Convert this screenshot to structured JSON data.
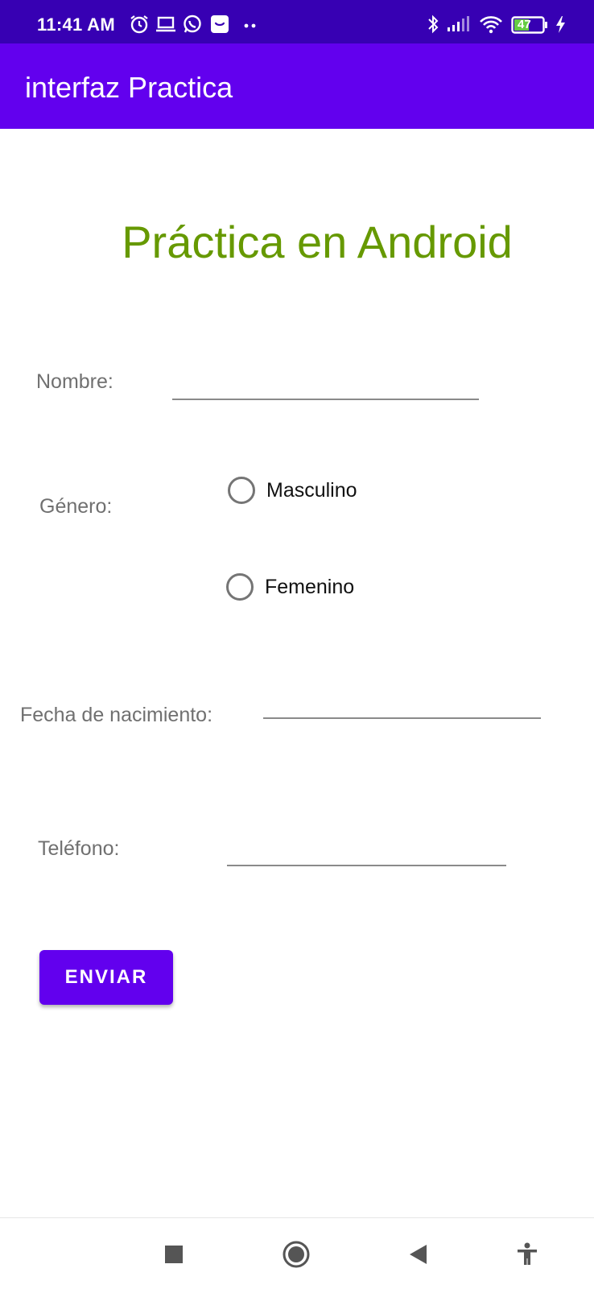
{
  "status_bar": {
    "time": "11:41 AM",
    "battery_level": "47",
    "icons": [
      "alarm-icon",
      "laptop-icon",
      "whatsapp-icon",
      "shop-icon",
      "more-dots-icon",
      "bluetooth-icon",
      "signal-icon",
      "wifi-icon",
      "battery-icon",
      "charging-icon"
    ]
  },
  "app_bar": {
    "title": "interfaz Practica"
  },
  "content": {
    "heading": "Práctica en Android",
    "name_label": "Nombre:",
    "gender_label": "Género:",
    "gender_options": [
      {
        "label": "Masculino",
        "selected": false
      },
      {
        "label": "Femenino",
        "selected": false
      }
    ],
    "birthdate_label": "Fecha de nacimiento:",
    "phone_label": "Teléfono:",
    "submit_label": "ENVIAR"
  },
  "nav_bar": {
    "icons": [
      "recents-square-icon",
      "home-circle-icon",
      "back-triangle-icon",
      "accessibility-icon"
    ]
  },
  "colors": {
    "status_bar": "#3700b3",
    "app_bar": "#6200ee",
    "heading": "#669900",
    "button": "#6200ee"
  }
}
